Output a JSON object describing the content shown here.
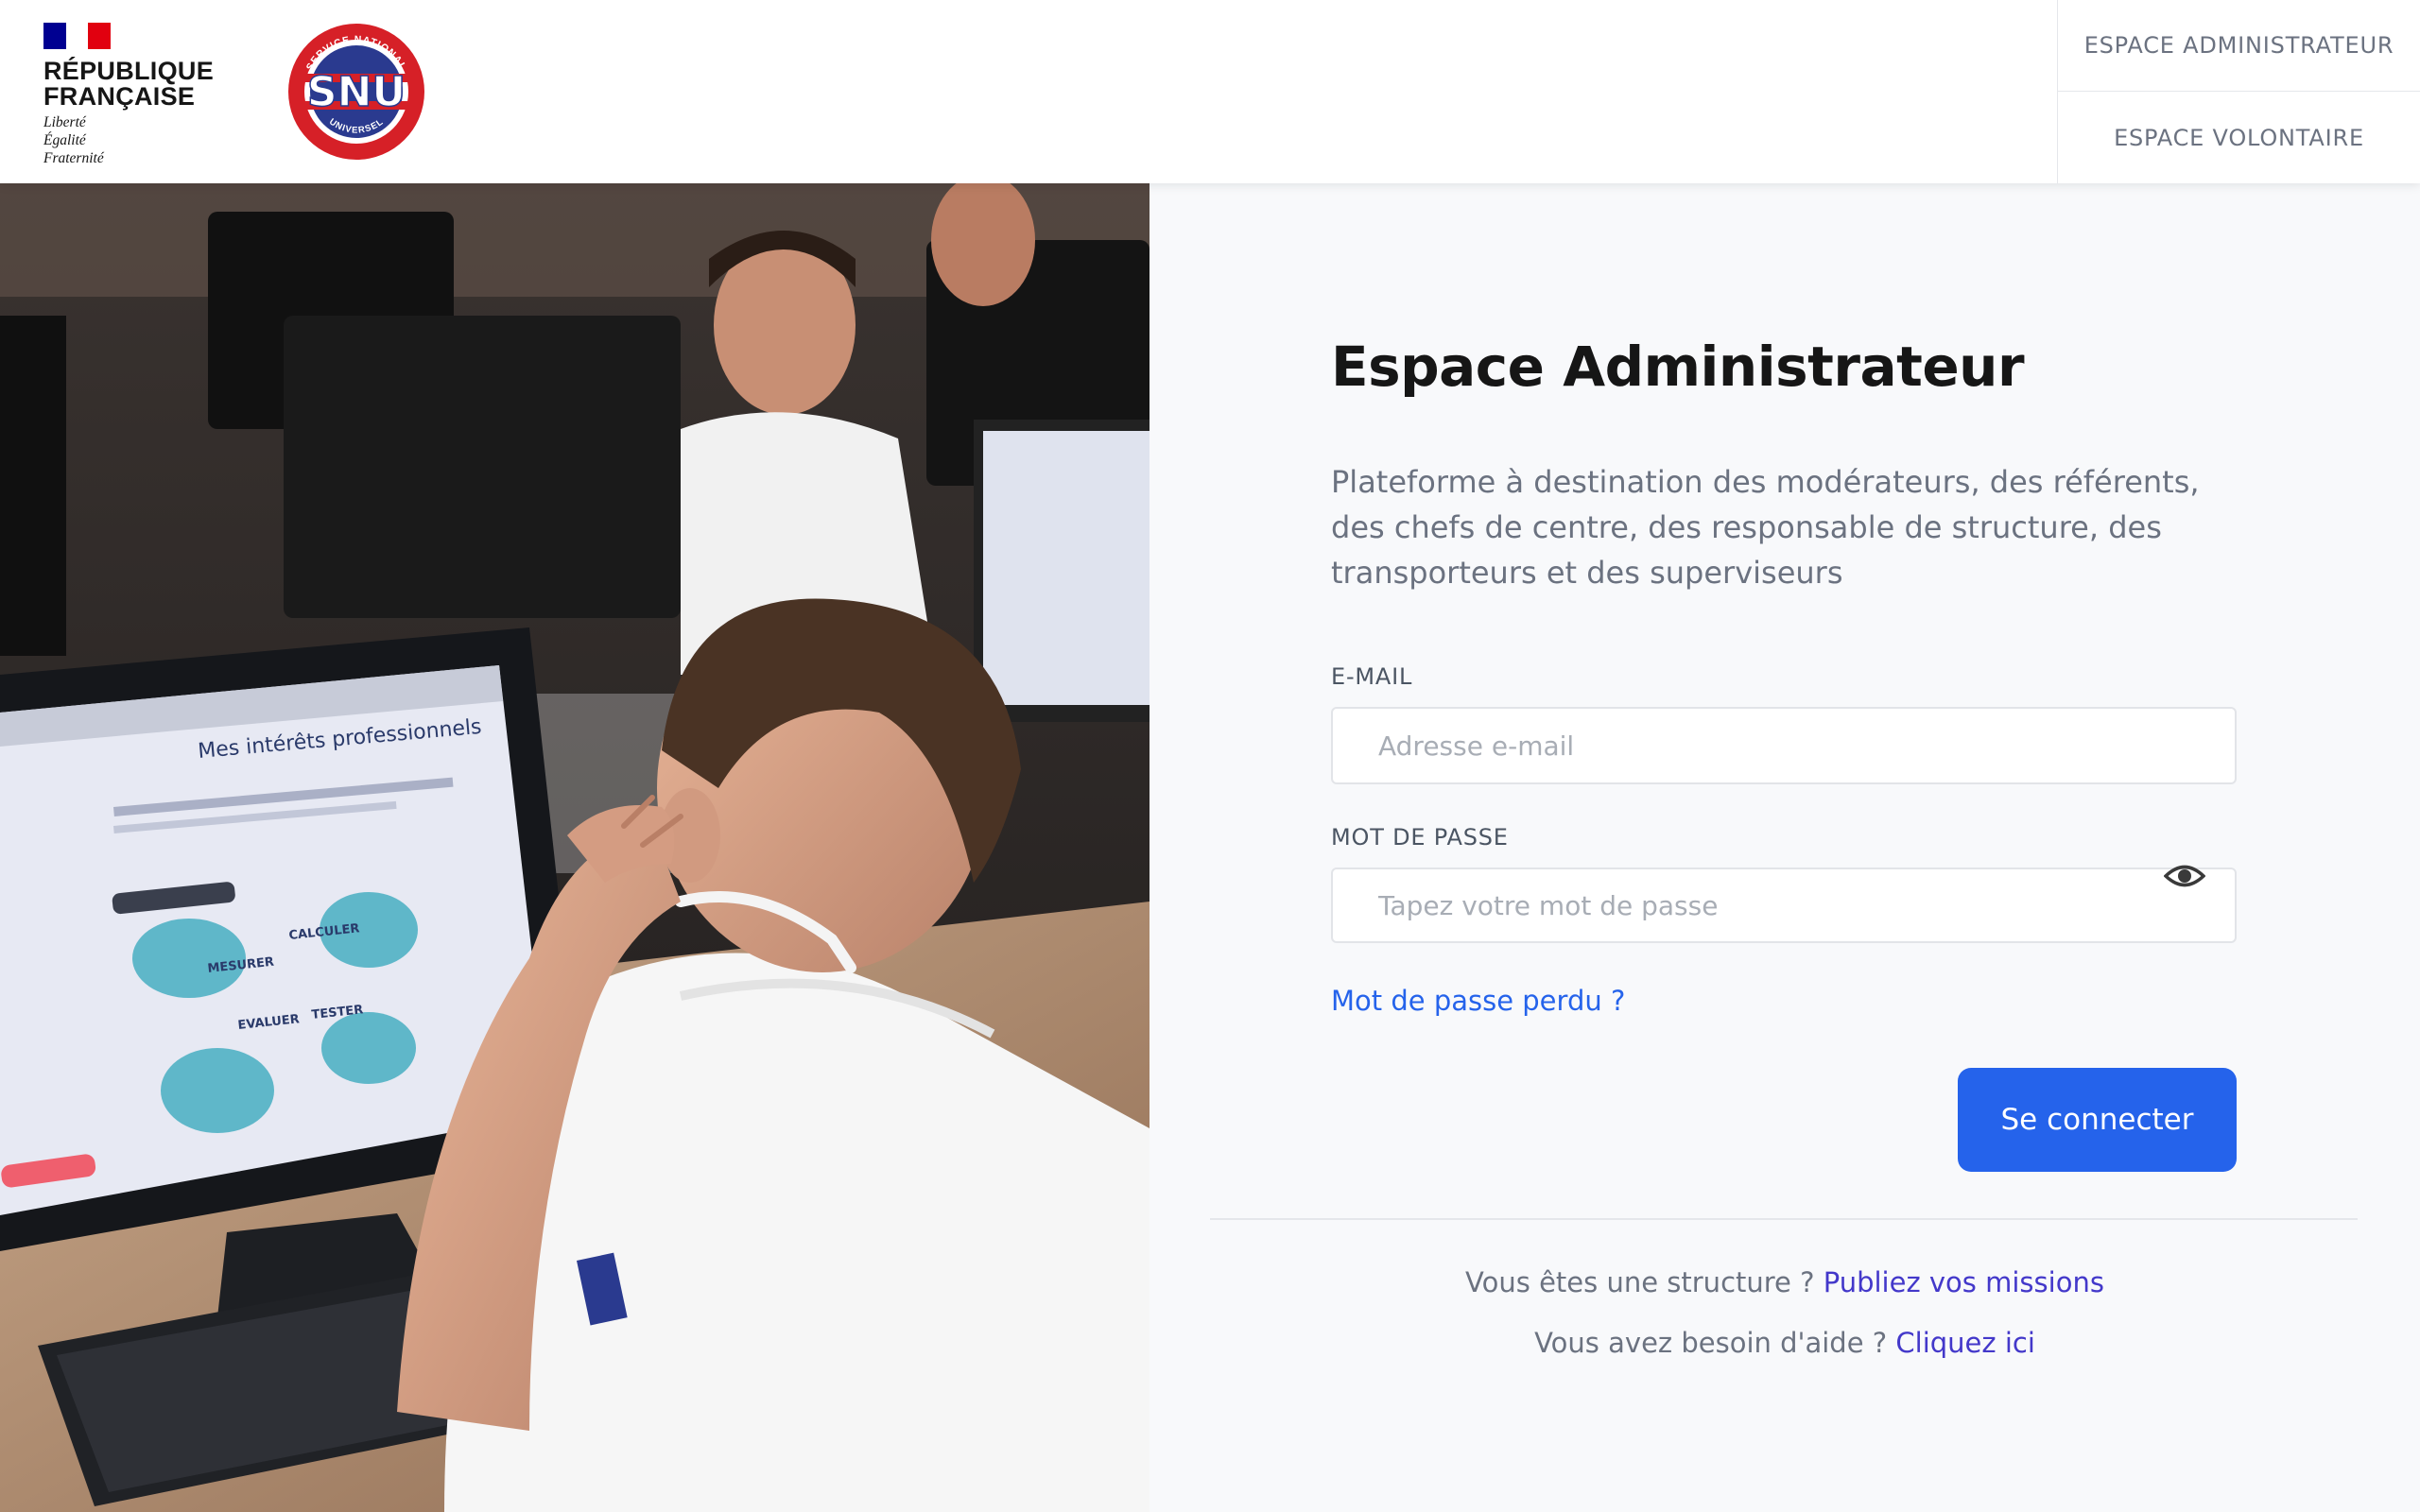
{
  "header": {
    "republic_name_line1": "RÉPUBLIQUE",
    "republic_name_line2": "FRANÇAISE",
    "motto_line1": "Liberté",
    "motto_line2": "Égalité",
    "motto_line3": "Fraternité",
    "snu_logo": {
      "initials": "SNU",
      "ring_top": "SERVICE NATIONAL",
      "ring_bottom": "UNIVERSEL"
    },
    "nav": {
      "admin_label": "ESPACE ADMINISTRATEUR",
      "volunteer_label": "ESPACE VOLONTAIRE"
    }
  },
  "photo": {
    "screen_heading": "Mes intérêts professionnels",
    "screen_words": [
      "MESURER",
      "CALCULER",
      "EVALUER",
      "TESTER"
    ]
  },
  "form": {
    "title": "Espace Administrateur",
    "description": "Plateforme à destination des modérateurs, des référents, des chefs de centre, des responsable de structure, des transporteurs et des superviseurs",
    "email_label": "E-MAIL",
    "email_placeholder": "Adresse e-mail",
    "email_value": "",
    "password_label": "MOT DE PASSE",
    "password_placeholder": "Tapez votre mot de passe",
    "password_value": "",
    "forgot_link": "Mot de passe perdu ?",
    "submit_label": "Se connecter"
  },
  "footer": {
    "structure_text": "Vous êtes une structure ?",
    "structure_link": "Publiez vos missions",
    "help_text": "Vous avez besoin d'aide ?",
    "help_link": "Cliquez ici"
  },
  "colors": {
    "primary": "#2563eb",
    "footer_link": "#4338ca",
    "flag_blue": "#000091",
    "flag_red": "#e1000f",
    "snu_red": "#d62027",
    "snu_blue": "#2a3a8f"
  },
  "icons": {
    "password_toggle": "eye-icon"
  }
}
